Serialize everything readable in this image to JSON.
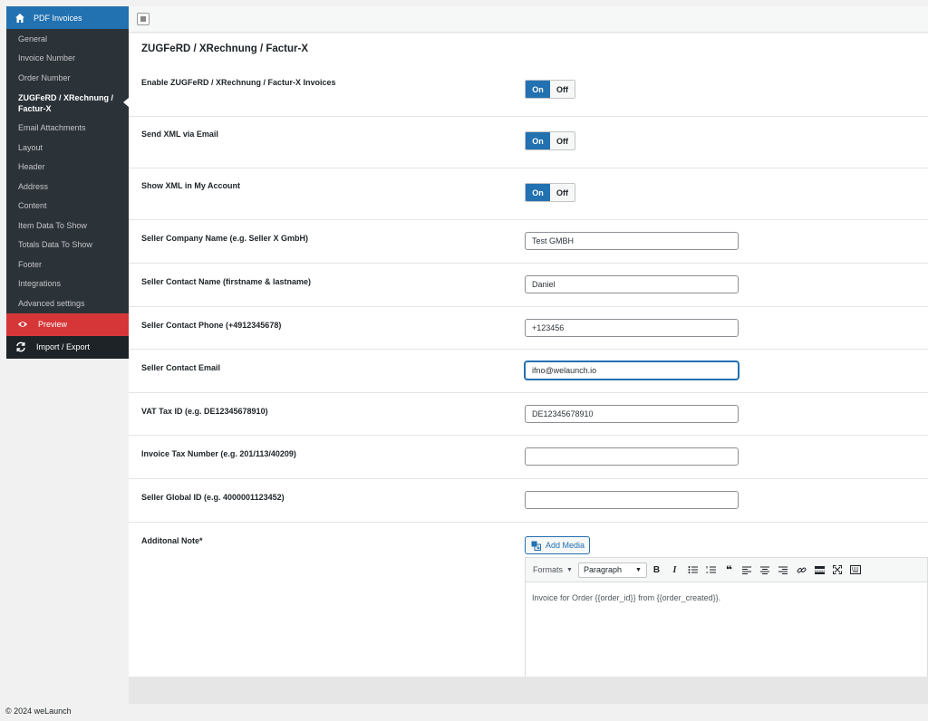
{
  "sidebar": {
    "header": "PDF Invoices",
    "items": [
      {
        "label": "General"
      },
      {
        "label": "Invoice Number"
      },
      {
        "label": "Order Number"
      },
      {
        "label": "ZUGFeRD / XRechnung / Factur-X",
        "active": true
      },
      {
        "label": "Email Attachments"
      },
      {
        "label": "Layout"
      },
      {
        "label": "Header"
      },
      {
        "label": "Address"
      },
      {
        "label": "Content"
      },
      {
        "label": "Item Data To Show"
      },
      {
        "label": "Totals Data To Show"
      },
      {
        "label": "Footer"
      },
      {
        "label": "Integrations"
      },
      {
        "label": "Advanced settings"
      }
    ],
    "preview": "Preview",
    "import_export": "Import / Export"
  },
  "page": {
    "title": "ZUGFeRD / XRechnung / Factur-X"
  },
  "toggles": {
    "on_label": "On",
    "off_label": "Off",
    "enable": {
      "label": "Enable ZUGFeRD / XRechnung / Factur-X Invoices",
      "state": "on"
    },
    "send_xml": {
      "label": "Send XML via Email",
      "state": "on"
    },
    "show_xml": {
      "label": "Show XML in My Account",
      "state": "on"
    }
  },
  "fields": {
    "company_name": {
      "label": "Seller Company Name (e.g. Seller X GmbH)",
      "value": "Test GMBH"
    },
    "contact_name": {
      "label": "Seller Contact Name (firstname & lastname)",
      "value": "Daniel"
    },
    "contact_phone": {
      "label": "Seller Contact Phone (+4912345678)",
      "value": "+123456"
    },
    "contact_email": {
      "label": "Seller Contact Email",
      "value": "ifno@welaunch.io"
    },
    "vat_id": {
      "label": "VAT Tax ID (e.g. DE12345678910)",
      "value": "DE12345678910"
    },
    "tax_number": {
      "label": "Invoice Tax Number (e.g. 201/113/40209)",
      "value": ""
    },
    "global_id": {
      "label": "Seller Global ID (e.g. 4000001123452)",
      "value": ""
    }
  },
  "note": {
    "label": "Additonal Note*",
    "add_media": "Add Media",
    "formats": "Formats",
    "paragraph": "Paragraph",
    "content": "Invoice for Order {{order_id}} from {{order_created}}."
  },
  "footer": {
    "copyright": "© 2024 weLaunch"
  },
  "colors": {
    "accent": "#2271b1",
    "sidebar_bg": "#2c3338",
    "preview_bg": "#d63638"
  }
}
